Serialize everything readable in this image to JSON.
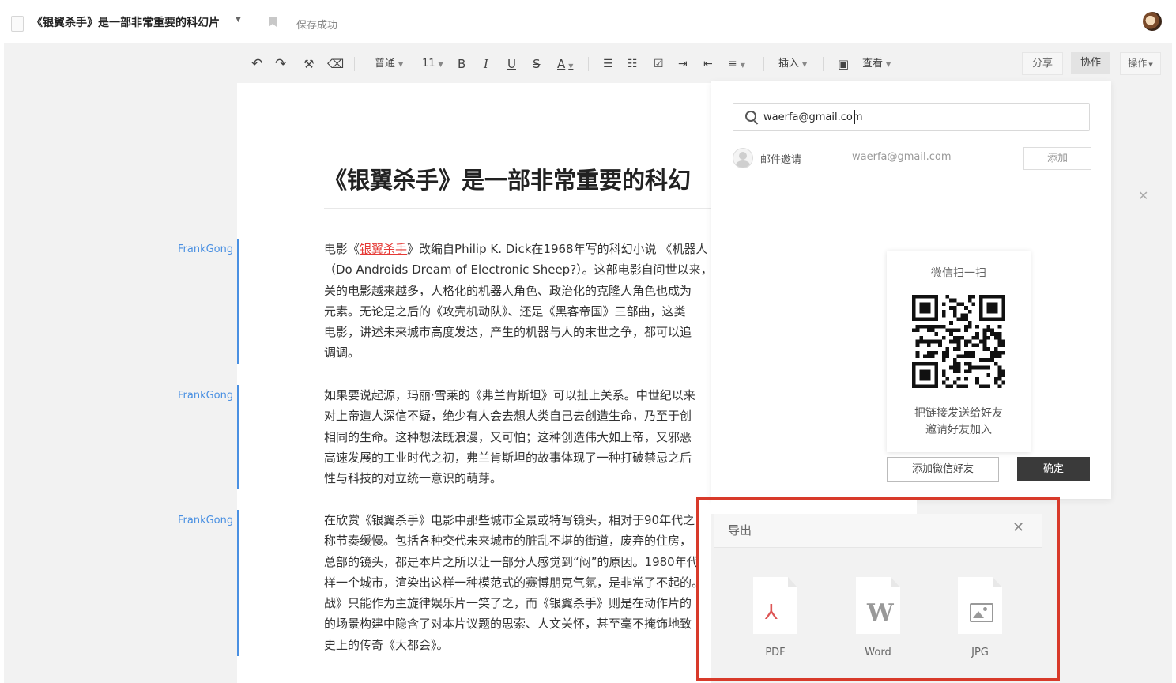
{
  "header": {
    "doc_title": "《银翼杀手》是一部非常重要的科幻片",
    "save_status": "保存成功"
  },
  "toolbar": {
    "style_label": "普通",
    "font_size": "11",
    "bold": "B",
    "italic": "I",
    "underline": "U",
    "strike": "S",
    "font_color": "A",
    "insert_label": "插入",
    "view_label": "查看",
    "share_label": "分享",
    "collab_label": "协作",
    "ops_label": "操作"
  },
  "document": {
    "title": "《银翼杀手》是一部非常重要的科幻",
    "paragraphs": [
      {
        "author": "FrankGong",
        "lines": [
          "电影《银翼杀手》改编自Philip K. Dick在1968年写的科幻小说 《机器人",
          "（Do Androids Dream of Electronic Sheep?）。这部电影自问世以来，",
          "关的电影越来越多，人格化的机器人角色、政治化的克隆人角色也成为",
          "元素。无论是之后的《攻壳机动队》、还是《黑客帝国》三部曲，这类",
          "电影，讲述未来城市高度发达，产生的机器与人的末世之争，都可以追",
          "调调。"
        ],
        "first_prefix": "电影《",
        "first_link": "银翼杀手",
        "first_suffix": "》改编自Philip K. Dick在1968年写的科幻小说 《机器人"
      },
      {
        "author": "FrankGong",
        "lines": [
          "如果要说起源，玛丽·雪莱的《弗兰肯斯坦》可以扯上关系。中世纪以来",
          "对上帝造人深信不疑，绝少有人会去想人类自己去创造生命，乃至于创",
          "相同的生命。这种想法既浪漫，又可怕；这种创造伟大如上帝，又邪恶",
          "高速发展的工业时代之初，弗兰肯斯坦的故事体现了一种打破禁忌之后",
          "性与科技的对立统一意识的萌芽。"
        ]
      },
      {
        "author": "FrankGong",
        "lines": [
          "在欣赏《银翼杀手》电影中那些城市全景或特写镜头，相对于90年代之",
          "称节奏缓慢。包括各种交代未来城市的脏乱不堪的街道，废弃的住房，",
          "总部的镜头，都是本片之所以让一部分人感觉到“闷”的原因。1980年代",
          "样一个城市，渲染出这样一种模范式的赛博朋克气氛，是非常了不起的。",
          "战》只能作为主旋律娱乐片一笑了之，而《银翼杀手》则是在动作片的",
          "的场景构建中隐含了对本片议题的思索、人文关怀，甚至毫不掩饰地致",
          "史上的传奇《大都会》。"
        ]
      }
    ]
  },
  "collab_panel": {
    "search_value": "waerfa@gmail.com",
    "invite_label": "邮件邀请",
    "invite_email": "waerfa@gmail.com",
    "add_label": "添加",
    "qr_title": "微信扫一扫",
    "qr_text1": "把链接发送给好友",
    "qr_text2": "邀请好友加入",
    "add_wechat_label": "添加微信好友",
    "confirm_label": "确定"
  },
  "export_dialog": {
    "title": "导出",
    "options": [
      {
        "label": "PDF",
        "icon": "pdf-icon"
      },
      {
        "label": "Word",
        "icon": "word-icon",
        "glyph": "W"
      },
      {
        "label": "JPG",
        "icon": "image-icon"
      }
    ]
  },
  "colors": {
    "accent_blue": "#4a90e2",
    "link_red": "#e53935",
    "highlight_red": "#d83a2a",
    "confirm_dark": "#3a3a3a"
  }
}
